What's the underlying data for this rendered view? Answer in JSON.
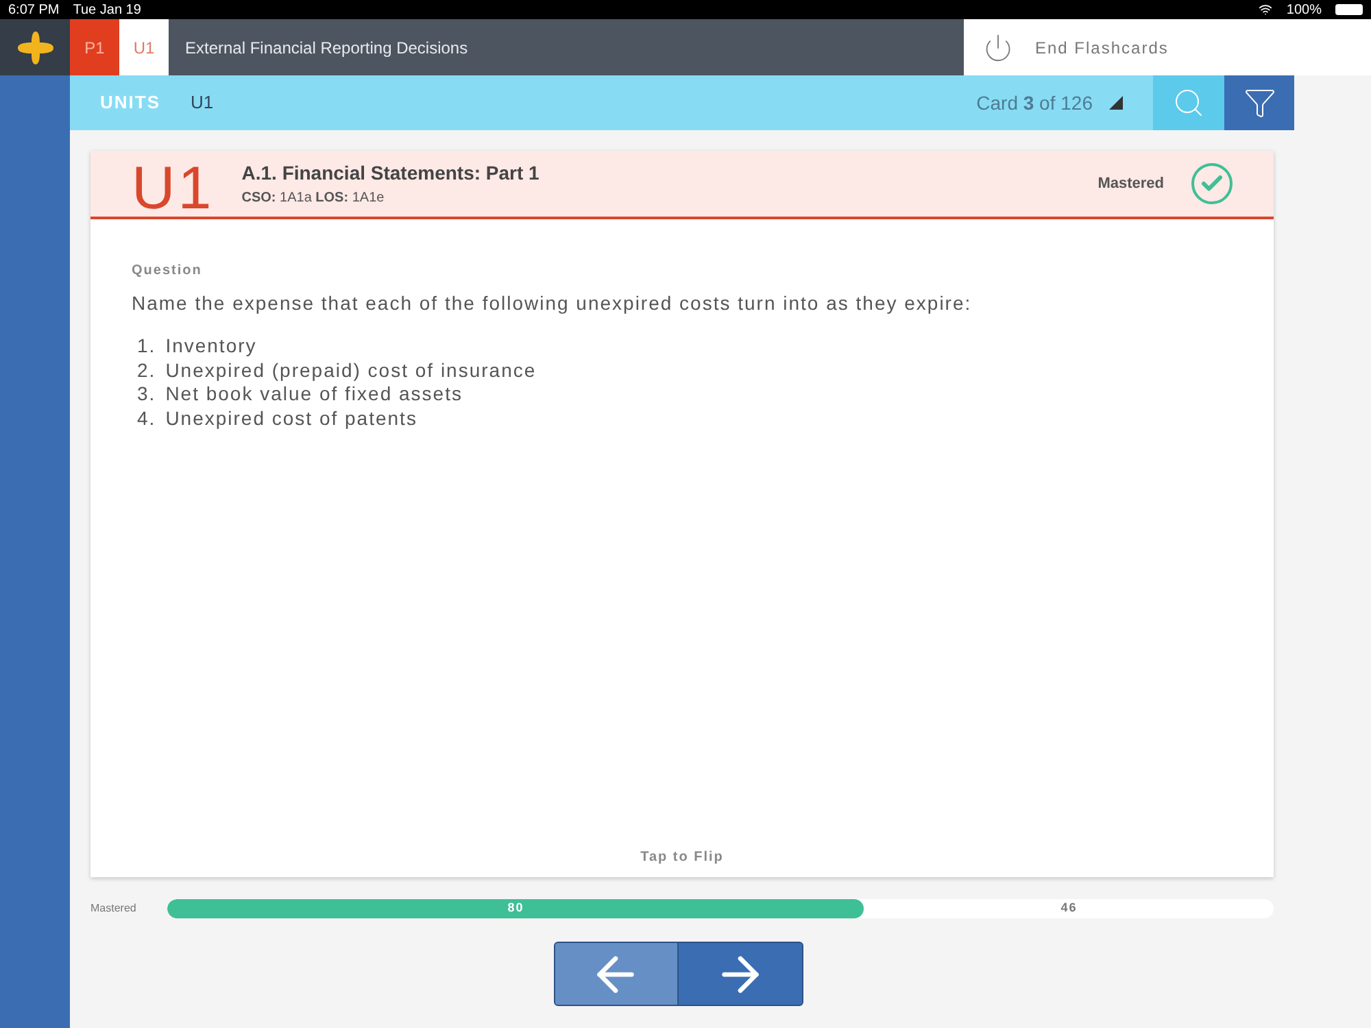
{
  "status_bar": {
    "time": "6:07 PM",
    "date": "Tue Jan 19",
    "battery": "100%"
  },
  "top_bar": {
    "part": "P1",
    "unit": "U1",
    "title": "External Financial Reporting Decisions",
    "end_button": "End Flashcards"
  },
  "units_bar": {
    "label": "UNITS",
    "unit": "U1",
    "card_counter": "Card **3** of 126"
  },
  "card": {
    "unit_mark": "U1",
    "title": "A.1. Financial Statements: Part 1",
    "codes": "**CSO:** 1A1a **LOS:** 1A1e",
    "status": "Mastered",
    "mastered": true,
    "question_label": "Question",
    "question": "Name the expense that each of the following unexpired costs turn into as they expire:",
    "items": [
      {
        "number": "1.",
        "text": "Inventory"
      },
      {
        "number": "2.",
        "text": "Unexpired (prepaid) cost of insurance"
      },
      {
        "number": "3.",
        "text": "Net book value of fixed assets"
      },
      {
        "number": "4.",
        "text": "Unexpired cost of patents"
      }
    ],
    "flip_hint": "Tap to Flip"
  },
  "progress": {
    "label": "Mastered",
    "level": 0.63,
    "mastered_count": "80",
    "remaining_count": "46"
  }
}
